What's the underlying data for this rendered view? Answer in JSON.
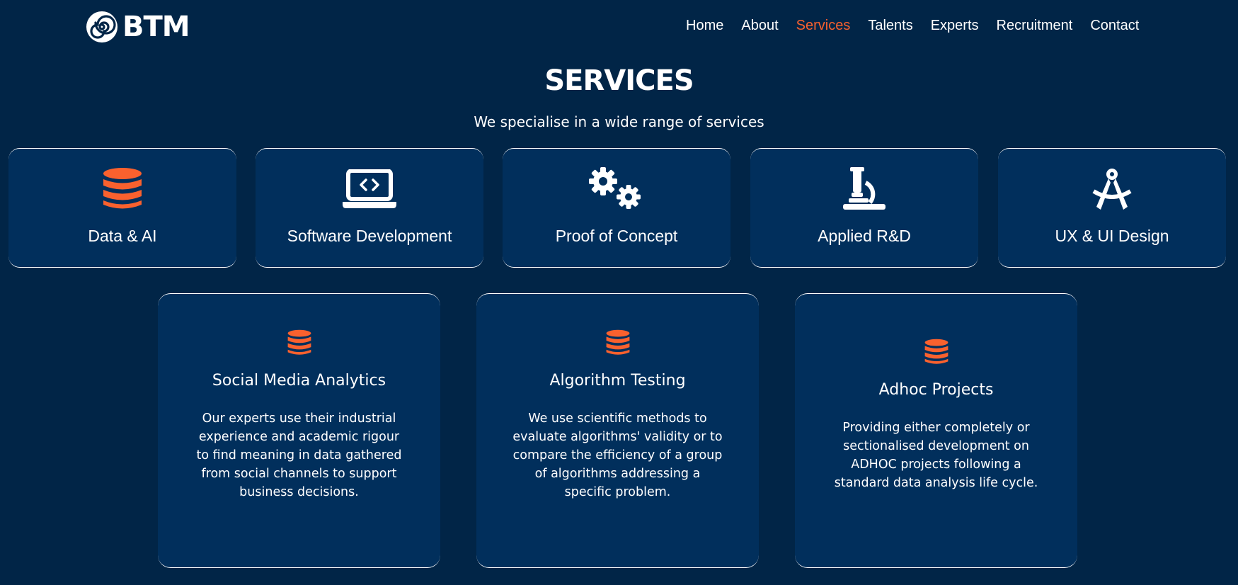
{
  "header": {
    "brand": "BTM",
    "nav": [
      {
        "label": "Home",
        "active": false
      },
      {
        "label": "About",
        "active": false
      },
      {
        "label": "Services",
        "active": true
      },
      {
        "label": "Talents",
        "active": false
      },
      {
        "label": "Experts",
        "active": false
      },
      {
        "label": "Recruitment",
        "active": false
      },
      {
        "label": "Contact",
        "active": false
      }
    ]
  },
  "main": {
    "title": "SERVICES",
    "subtitle": "We specialise in a wide range of services",
    "services": [
      {
        "label": "Data & AI",
        "icon": "database-icon"
      },
      {
        "label": "Software Development",
        "icon": "laptop-code-icon"
      },
      {
        "label": "Proof of Concept",
        "icon": "gears-icon"
      },
      {
        "label": "Applied R&D",
        "icon": "microscope-icon"
      },
      {
        "label": "UX & UI Design",
        "icon": "compass-drafting-icon"
      }
    ],
    "details": [
      {
        "title": "Social Media Analytics",
        "icon": "database-icon",
        "text": "Our experts use their industrial experience and academic rigour to find meaning in data gathered from social channels to support business decisions."
      },
      {
        "title": "Algorithm Testing",
        "icon": "database-icon",
        "text": "We use scientific methods to evaluate algorithms' validity or to compare the efficiency of a group of algorithms addressing a specific problem."
      },
      {
        "title": "Adhoc Projects",
        "icon": "database-icon",
        "text": "Providing either completely or sectionalised development on ADHOC projects following a standard data analysis life cycle."
      }
    ]
  },
  "colors": {
    "background": "#012547",
    "card": "#012f5c",
    "accent": "#f9612e",
    "text": "#ffffff"
  }
}
